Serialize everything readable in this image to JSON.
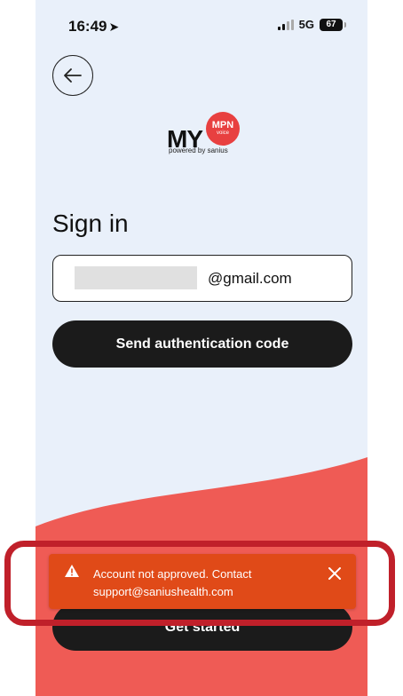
{
  "status_bar": {
    "time": "16:49",
    "network": "5G",
    "battery": "67"
  },
  "logo": {
    "my": "MY",
    "badge_main": "MPN",
    "badge_sub": "voice",
    "powered_by": "powered by sanius"
  },
  "page": {
    "title": "Sign in"
  },
  "email": {
    "visible_value": "@gmail.com"
  },
  "buttons": {
    "send_code": "Send authentication code",
    "get_started": "Get started"
  },
  "toast": {
    "message": "Account not approved. Contact support@saniushealth.com",
    "background_color": "#e04a18"
  },
  "colors": {
    "screen_bg": "#e9f0fa",
    "wave": "#ef5b55",
    "highlight": "#c0202a",
    "primary_button": "#1b1b1b"
  }
}
